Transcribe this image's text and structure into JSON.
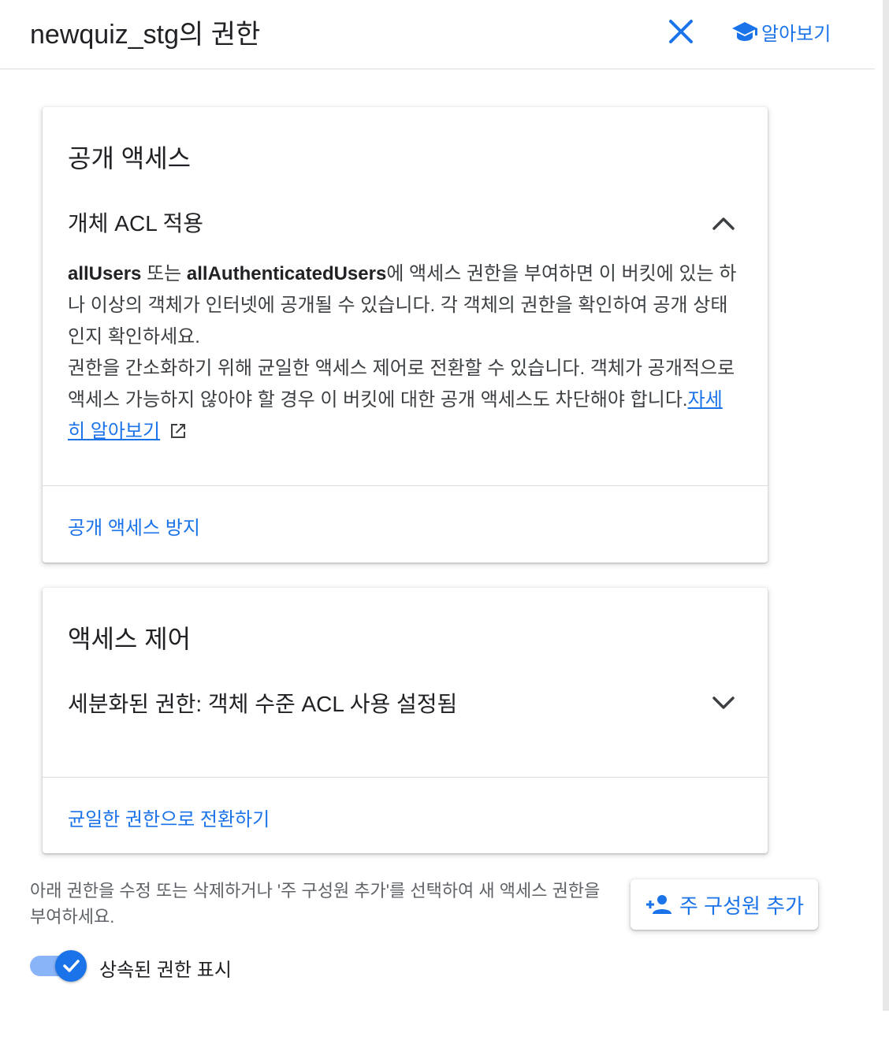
{
  "header": {
    "title": "newquiz_stg의 권한",
    "close_icon": "close-icon",
    "learn_label": "알아보기",
    "learn_icon": "school-icon"
  },
  "public_access_card": {
    "title": "공개 액세스",
    "section_title": "개체 ACL 적용",
    "section_expanded": true,
    "body": {
      "bold_1": "allUsers",
      "text_1": " 또는 ",
      "bold_2": "allAuthenticatedUsers",
      "text_2": "에 액세스 권한을 부여하면 이 버킷에 있는 하나 이상의 객체가 인터넷에 공개될 수 있습니다. 각 객체의 권한을 확인하여 공개 상태인지 확인하세요.",
      "text_3": "권한을 간소화하기 위해 균일한 액세스 제어로 전환할 수 있습니다. 객체가 공개적으로 액세스 가능하지 않아야 할 경우 이 버킷에 대한 공개 액세스도 차단해야 합니다.",
      "link_label": "자세히 알아보기",
      "link_icon": "open-in-new-icon"
    },
    "action_label": "공개 액세스 방지"
  },
  "access_control_card": {
    "title": "액세스 제어",
    "section_title": "세분화된 권한: 객체 수준 ACL 사용 설정됨",
    "section_expanded": false,
    "action_label": "균일한 권한으로 전환하기"
  },
  "footer": {
    "hint": "아래 권한을 수정 또는 삭제하거나 '주 구성원 추가'를 선택하여 새 액세스 권한을 부여하세요.",
    "add_button_label": "주 구성원 추가",
    "add_button_icon": "person-add-icon",
    "toggle_label": "상속된 권한 표시",
    "toggle_checked": true
  },
  "colors": {
    "accent": "#1a73e8",
    "toggle_track": "#8ab4f8",
    "divider": "#dadce0",
    "text": "#202124",
    "secondary_text": "#5f6368"
  }
}
